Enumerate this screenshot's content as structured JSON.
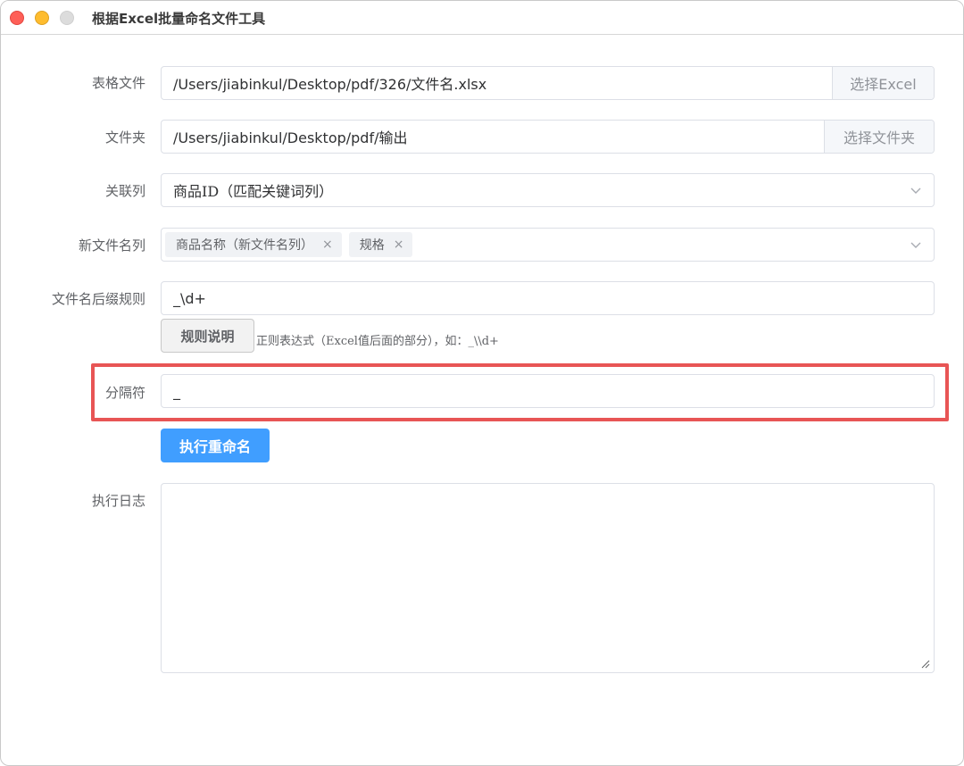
{
  "window": {
    "title": "根据Excel批量命名文件工具"
  },
  "form": {
    "table_file": {
      "label": "表格文件",
      "value": "/Users/jiabinkul/Desktop/pdf/326/文件名.xlsx",
      "button": "选择Excel"
    },
    "folder": {
      "label": "文件夹",
      "value": "/Users/jiabinkul/Desktop/pdf/输出",
      "button": "选择文件夹"
    },
    "link_column": {
      "label": "关联列",
      "value": "商品ID（匹配关键词列）",
      "icon": "chevron-down-icon"
    },
    "new_name_column": {
      "label": "新文件名列",
      "tags": [
        {
          "text": "商品名称（新文件名列）",
          "remove": "×"
        },
        {
          "text": "规格",
          "remove": "×"
        }
      ],
      "icon": "chevron-down-icon"
    },
    "suffix_rule": {
      "label": "文件名后缀规则",
      "value": "_\\d+",
      "button": "规则说明",
      "hint": "正则表达式（Excel值后面的部分），如：_\\\\d+"
    },
    "separator": {
      "label": "分隔符",
      "value": "_",
      "highlight_color": "#e85555"
    },
    "run_button": "执行重命名",
    "log": {
      "label": "执行日志",
      "value": ""
    }
  },
  "colors": {
    "primary": "#409eff",
    "highlight": "#e85555"
  }
}
